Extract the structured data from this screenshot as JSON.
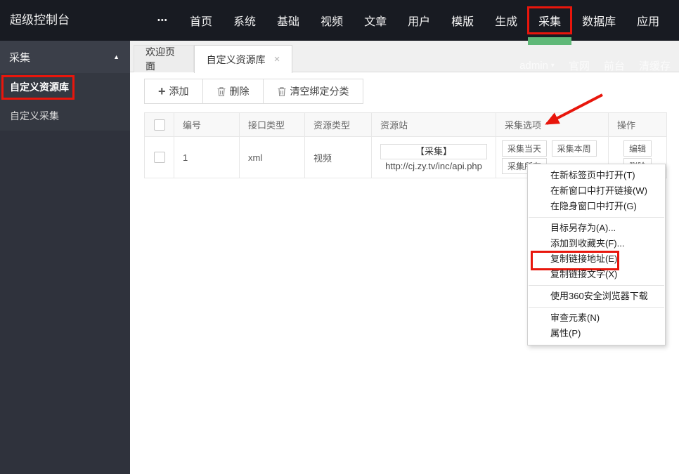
{
  "topbar": {
    "brand": "超级控制台",
    "more_icon": "•••",
    "menu": [
      "首页",
      "系统",
      "基础",
      "视频",
      "文章",
      "用户",
      "模版",
      "生成",
      "采集",
      "数据库",
      "应用"
    ],
    "active_item": "采集"
  },
  "sidebar": {
    "group": {
      "label": "采集",
      "collapse_icon": "▲"
    },
    "items": [
      {
        "label": "自定义资源库",
        "highlighted": true
      },
      {
        "label": "自定义采集",
        "highlighted": false
      }
    ]
  },
  "tabbar": {
    "tabs": [
      {
        "label": "欢迎页面"
      },
      {
        "label": "自定义资源库",
        "close_icon": "×",
        "active": true
      }
    ],
    "userbar": {
      "username": "admin",
      "caret_icon": "▾",
      "links": [
        "官网",
        "前台",
        "清缓存"
      ]
    }
  },
  "toolbar": {
    "plus_icon": "+",
    "add_label": "添加",
    "delete_label": "删除",
    "clear_label": "清空绑定分类"
  },
  "table": {
    "columns": [
      "编号",
      "接口类型",
      "资源类型",
      "资源站",
      "采集选项",
      "操作"
    ],
    "row": {
      "id": "1",
      "interface_type": "xml",
      "resource_type": "视频",
      "site_name": "【采集】",
      "site_url": "http://cj.zy.tv/inc/api.php",
      "collect_options": [
        "采集当天",
        "采集本周",
        "采集所有"
      ],
      "actions": [
        "编辑",
        "删除"
      ]
    }
  },
  "context_menu": {
    "items": [
      "在新标签页中打开(T)",
      "在新窗口中打开链接(W)",
      "在隐身窗口中打开(G)",
      "目标另存为(A)...",
      "添加到收藏夹(F)...",
      "复制链接地址(E)",
      "复制链接文字(X)",
      "使用360安全浏览器下载",
      "审查元素(N)",
      "属性(P)"
    ],
    "highlighted_item": "复制链接地址(E)"
  },
  "annotations": {
    "highlight_color": "#e8160c",
    "active_tab_underline_color": "#5FB878"
  }
}
